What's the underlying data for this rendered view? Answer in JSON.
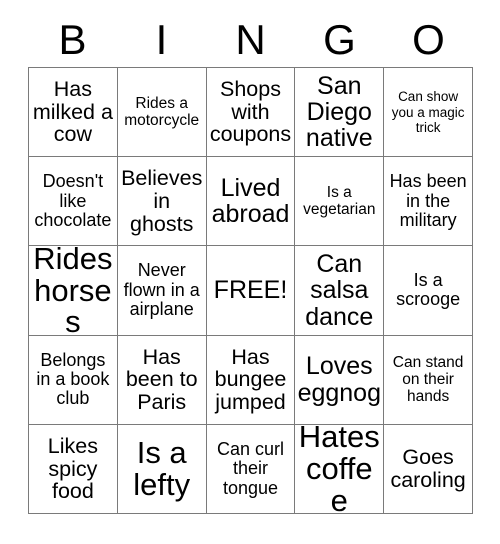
{
  "card": {
    "header_letters": [
      "B",
      "I",
      "N",
      "G",
      "O"
    ],
    "free_space_label": "FREE!",
    "colors": {
      "background": "#ffffff",
      "text": "#000000",
      "grid_line": "#7a7a7a"
    },
    "rows": [
      [
        {
          "text": "Has milked a cow",
          "size": "l"
        },
        {
          "text": "Rides a motorcycle",
          "size": "s"
        },
        {
          "text": "Shops with coupons",
          "size": "l"
        },
        {
          "text": "San Diego native",
          "size": "xl"
        },
        {
          "text": "Can show you a magic trick",
          "size": "xs"
        }
      ],
      [
        {
          "text": "Doesn't like chocolate",
          "size": "m"
        },
        {
          "text": "Believes in ghosts",
          "size": "l"
        },
        {
          "text": "Lived abroad",
          "size": "xl"
        },
        {
          "text": "Is a vegetarian",
          "size": "s"
        },
        {
          "text": "Has been in the military",
          "size": "m"
        }
      ],
      [
        {
          "text": "Rides horses",
          "size": "xxl"
        },
        {
          "text": "Never flown in a airplane",
          "size": "m"
        },
        {
          "text": "FREE!",
          "size": "free"
        },
        {
          "text": "Can salsa dance",
          "size": "xl"
        },
        {
          "text": "Is a scrooge",
          "size": "m"
        }
      ],
      [
        {
          "text": "Belongs in a book club",
          "size": "m"
        },
        {
          "text": "Has been to Paris",
          "size": "l"
        },
        {
          "text": "Has bungee jumped",
          "size": "l"
        },
        {
          "text": "Loves eggnog",
          "size": "xl"
        },
        {
          "text": "Can stand on their hands",
          "size": "s"
        }
      ],
      [
        {
          "text": "Likes spicy food",
          "size": "l"
        },
        {
          "text": "Is a lefty",
          "size": "xxl"
        },
        {
          "text": "Can curl their tongue",
          "size": "m"
        },
        {
          "text": "Hates coffee",
          "size": "xxl"
        },
        {
          "text": "Goes caroling",
          "size": "l"
        }
      ]
    ]
  }
}
